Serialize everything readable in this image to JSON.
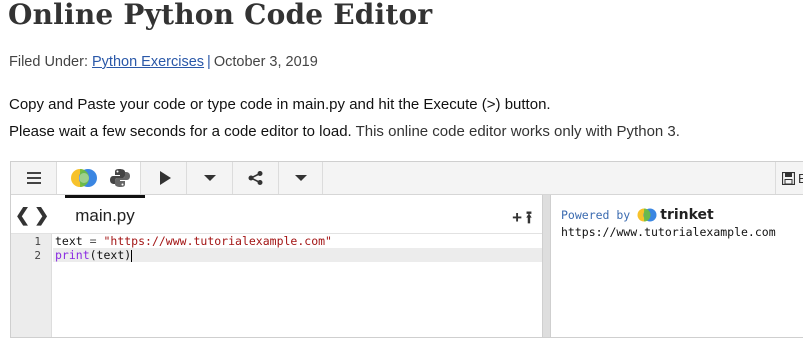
{
  "page": {
    "title": "Online Python Code Editor",
    "filed_under_label": "Filed Under:",
    "category_link": "Python Exercises",
    "separator": "|",
    "date": "October 3, 2019",
    "description_line1": "Copy and Paste your code or type code in main.py and hit the Execute (>) button.",
    "description_line2_a": "Please wait a few seconds for a code editor to load.",
    "description_line2_b": " This online code editor works only with Python 3."
  },
  "toolbar": {
    "menu_icon": "hamburger-icon",
    "logo_icon": "trinket-logo-icon",
    "python_icon": "python-icon",
    "run_icon": "play-icon",
    "run_dropdown_icon": "caret-down-icon",
    "share_icon": "share-icon",
    "share_dropdown_icon": "caret-down-icon",
    "save_icon": "save-icon",
    "save_label": "E"
  },
  "editor": {
    "nav_prev_icon": "chevron-left-icon",
    "nav_next_icon": "chevron-right-icon",
    "tab_label": "main.py",
    "add_file_icon": "plus-icon",
    "upload_icon": "upload-icon",
    "line_numbers": [
      "1",
      "2"
    ],
    "lines": [
      {
        "var": "text",
        "op": " = ",
        "str": "\"https://www.tutorialexample.com\""
      },
      {
        "kw": "print",
        "rest": "(text)"
      }
    ]
  },
  "output_panel": {
    "powered_by": "Powered by",
    "brand": "trinket",
    "output_text": "https://www.tutorialexample.com"
  },
  "colors": {
    "link": "#2a58a8",
    "string": "#a31515",
    "keyword": "#8a2be2",
    "powered_by": "#3b6bb0"
  }
}
